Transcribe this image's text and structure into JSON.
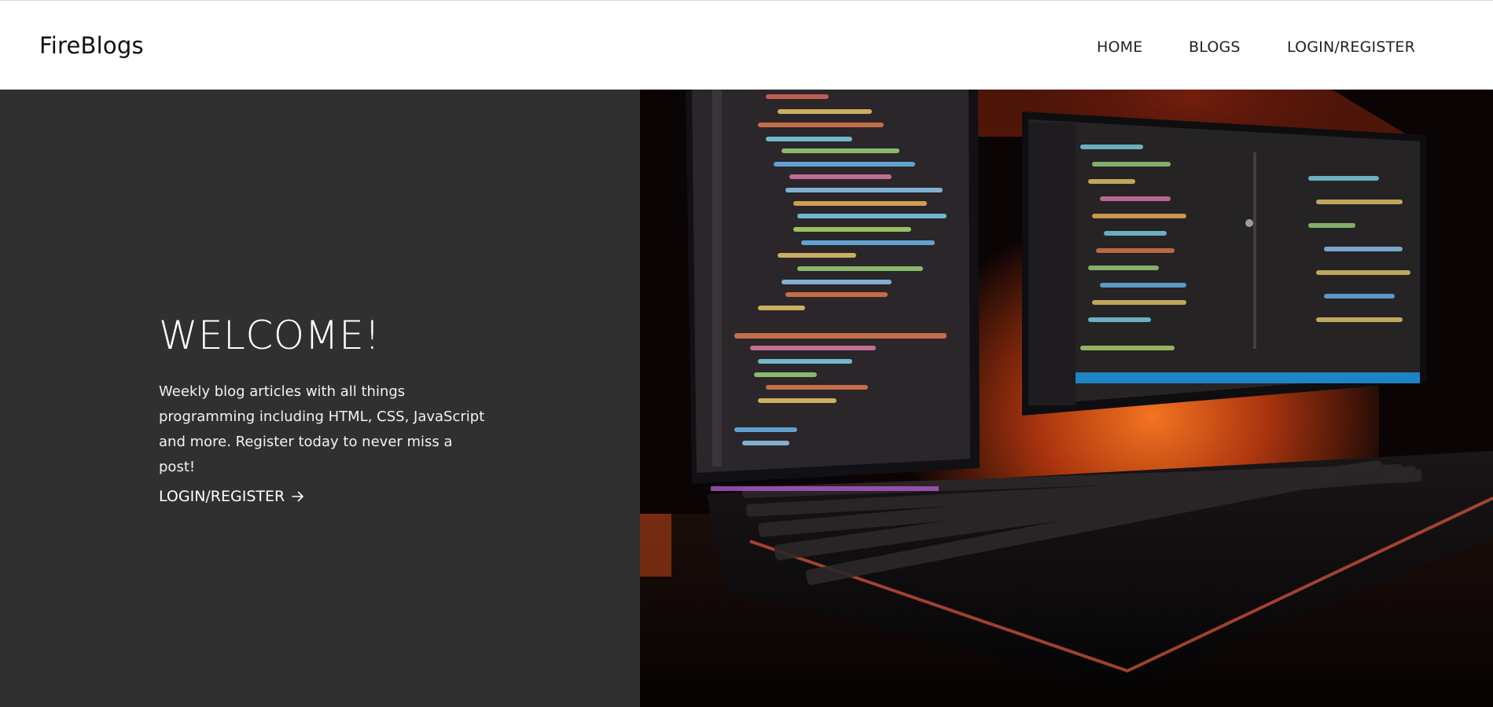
{
  "header": {
    "logo": "FireBlogs",
    "nav": [
      {
        "label": "HOME"
      },
      {
        "label": "BLOGS"
      },
      {
        "label": "LOGIN/REGISTER"
      }
    ]
  },
  "hero": {
    "title": "WELCOME!",
    "description": "Weekly blog articles with all things programming including HTML, CSS, JavaScript and more. Register today to never miss a post!",
    "cta_label": "LOGIN/REGISTER",
    "cta_icon": "arrow-right-icon",
    "image": "monitors-keyboard-photo"
  },
  "colors": {
    "header_bg": "#ffffff",
    "hero_bg": "#303030",
    "text_light": "#ffffff",
    "accent_glow": "#e05a1a"
  }
}
